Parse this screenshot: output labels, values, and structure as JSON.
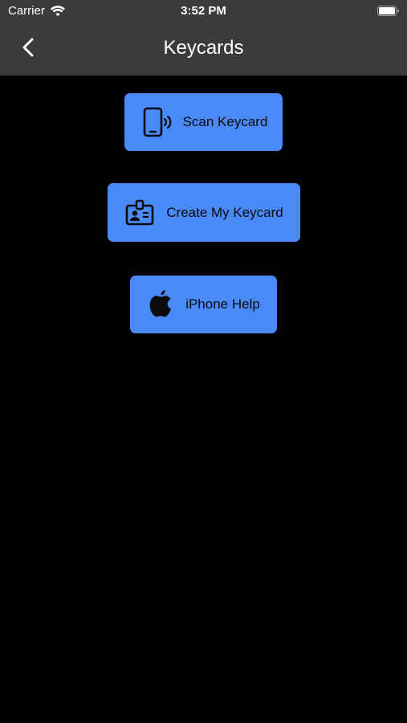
{
  "status_bar": {
    "carrier": "Carrier",
    "time": "3:52 PM"
  },
  "nav": {
    "title": "Keycards",
    "back_icon": "chevron-left-icon"
  },
  "buttons": {
    "scan_keycard": {
      "label": "Scan Keycard",
      "icon": "phone-nfc-icon"
    },
    "create_keycard": {
      "label": "Create My Keycard",
      "icon": "id-badge-icon"
    },
    "iphone_help": {
      "label": "iPhone Help",
      "icon": "apple-logo-icon"
    }
  },
  "colors": {
    "bar_background": "#3b3b3b",
    "page_background": "#000000",
    "button_background": "#4a89f8",
    "button_text": "#0b0b0b"
  }
}
